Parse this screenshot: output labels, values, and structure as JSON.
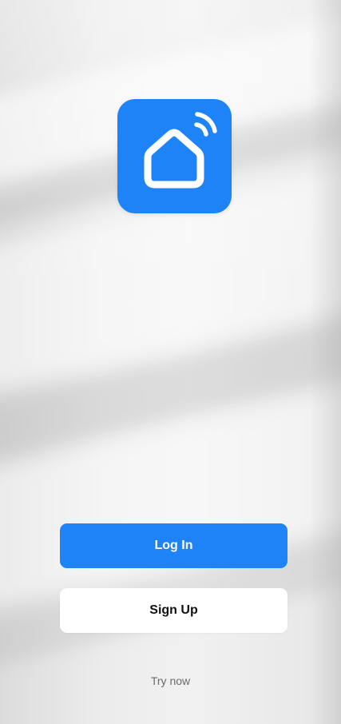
{
  "app": {
    "logo_icon": "smart-home-wifi-icon",
    "brand_color": "#1e83f6"
  },
  "actions": {
    "login_label": "Log In",
    "signup_label": "Sign Up",
    "try_now_label": "Try now"
  }
}
